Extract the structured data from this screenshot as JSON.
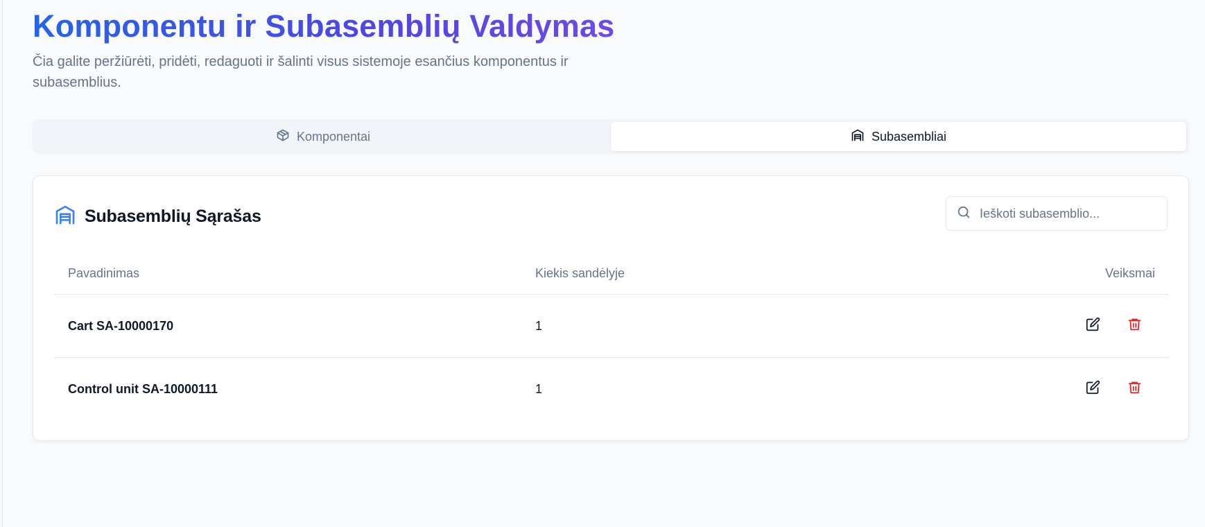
{
  "header": {
    "title": "Komponentu ir Subasemblių Valdymas",
    "subtitle": "Čia galite peržiūrėti, pridėti, redaguoti ir šalinti visus sistemoje esančius komponentus ir subasemblius."
  },
  "tabs": [
    {
      "label": "Komponentai",
      "icon": "box-icon",
      "active": false
    },
    {
      "label": "Subasembliai",
      "icon": "warehouse-icon",
      "active": true
    }
  ],
  "list": {
    "title": "Subasemblių Sąrašas",
    "icon": "warehouse-icon",
    "search": {
      "placeholder": "Ieškoti subasemblio...",
      "value": ""
    },
    "columns": [
      "Pavadinimas",
      "Kiekis sandėlyje",
      "Veiksmai"
    ],
    "rows": [
      {
        "name": "Cart SA-10000170",
        "qty": "1"
      },
      {
        "name": "Control unit SA-10000111",
        "qty": "1"
      }
    ]
  },
  "colors": {
    "title_gradient_start": "#2563eb",
    "title_gradient_end": "#6d4ae8",
    "accent_icon": "#3b82f6",
    "delete": "#dc2626"
  }
}
